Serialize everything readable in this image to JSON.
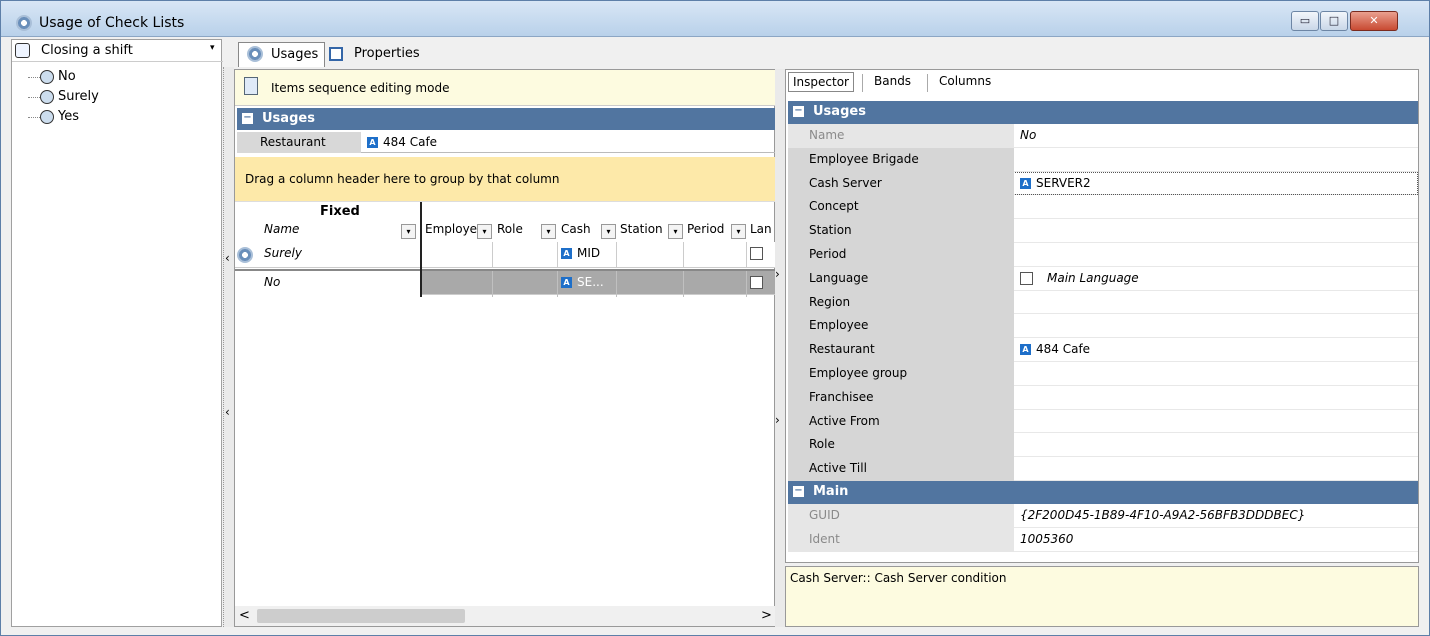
{
  "window": {
    "title": "Usage of Check Lists",
    "minimize_glyph": "▭",
    "maximize_glyph": "□",
    "close_glyph": "✕"
  },
  "left_panel": {
    "combo_value": "Closing a shift",
    "combo_arrow": "▾",
    "tree_items": [
      "No",
      "Surely",
      "Yes"
    ]
  },
  "tabs": [
    "Usages",
    "Properties"
  ],
  "center": {
    "mode_text": "Items sequence editing mode",
    "usages_header": "Usages",
    "restaurant_label": "Restaurant",
    "restaurant_value": "484 Cafe",
    "group_panel_text": "Drag a column header here to group by that column",
    "fixed_label": "Fixed",
    "columns": [
      "Name",
      "Employe",
      "Role",
      "Cash",
      "Station",
      "Period",
      "Lan"
    ],
    "rows": [
      {
        "name": "Surely",
        "cash": "MID",
        "lang": ""
      },
      {
        "name": "No",
        "cash": "SE...",
        "lang": ""
      }
    ],
    "scroll_left": "<",
    "scroll_right": ">"
  },
  "inspector": {
    "tabs": [
      "Inspector",
      "Bands",
      "Columns"
    ],
    "usages_header": "Usages",
    "main_header": "Main",
    "usages_rows": [
      {
        "key": "Name",
        "value": "No",
        "disabled": true,
        "italic": true
      },
      {
        "key": "Employee Brigade",
        "value": ""
      },
      {
        "key": "Cash Server",
        "value": "SERVER2",
        "badge": true
      },
      {
        "key": "Concept",
        "value": ""
      },
      {
        "key": "Station",
        "value": ""
      },
      {
        "key": "Period",
        "value": ""
      },
      {
        "key": "Language",
        "value": "Main Language",
        "checkbox": true,
        "italic": true
      },
      {
        "key": "Region",
        "value": ""
      },
      {
        "key": "Employee",
        "value": ""
      },
      {
        "key": "Restaurant",
        "value": "484 Cafe",
        "badge": true
      },
      {
        "key": "Employee group",
        "value": ""
      },
      {
        "key": "Franchisee",
        "value": ""
      },
      {
        "key": "Active From",
        "value": ""
      },
      {
        "key": "Role",
        "value": ""
      },
      {
        "key": "Active Till",
        "value": ""
      }
    ],
    "main_rows": [
      {
        "key": "GUID",
        "value": "{2F200D45-1B89-4F10-A9A2-56BFB3DDDBEC}",
        "disabled": true,
        "italic": true
      },
      {
        "key": "Ident",
        "value": "1005360",
        "disabled": true,
        "italic": true
      }
    ],
    "description": "Cash Server:: Cash Server condition"
  }
}
